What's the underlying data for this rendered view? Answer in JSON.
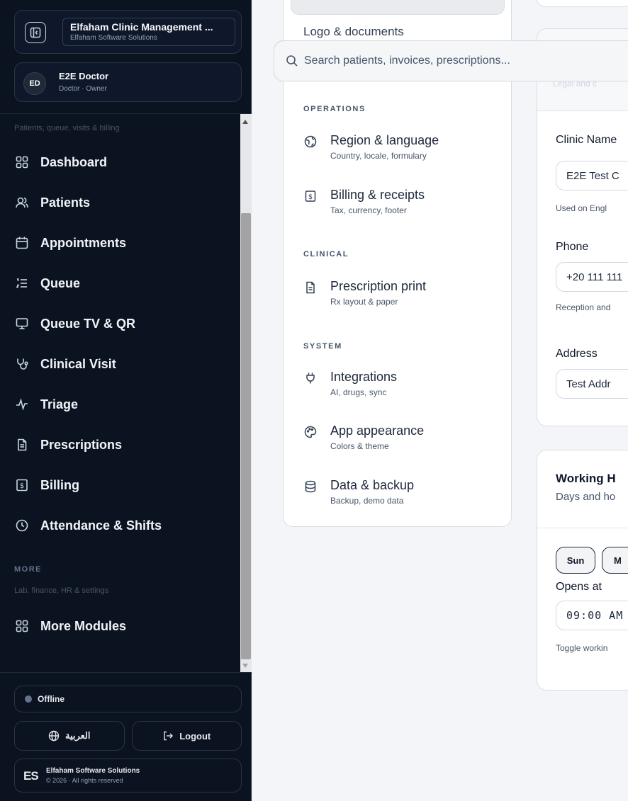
{
  "sidebar": {
    "brand": {
      "title": "Elfaham Clinic Management ...",
      "subtitle": "Elfaham Software Solutions"
    },
    "user": {
      "initials": "ED",
      "name": "E2E Doctor",
      "role": "Doctor · Owner"
    },
    "nav_caption": "Patients, queue, visits & billing",
    "items": [
      {
        "label": "Dashboard",
        "icon": "grid-icon"
      },
      {
        "label": "Patients",
        "icon": "users-icon"
      },
      {
        "label": "Appointments",
        "icon": "calendar-icon"
      },
      {
        "label": "Queue",
        "icon": "list-ordered-icon"
      },
      {
        "label": "Queue TV & QR",
        "icon": "monitor-icon"
      },
      {
        "label": "Clinical Visit",
        "icon": "stethoscope-icon"
      },
      {
        "label": "Triage",
        "icon": "activity-icon"
      },
      {
        "label": "Prescriptions",
        "icon": "file-text-icon"
      },
      {
        "label": "Billing",
        "icon": "receipt-icon"
      },
      {
        "label": "Attendance & Shifts",
        "icon": "clock-icon"
      }
    ],
    "more_heading": "MORE",
    "more_caption": "Lab, finance, HR & settings",
    "more_modules": "More Modules",
    "status": "Offline",
    "language_button": "العربية",
    "logout_button": "Logout",
    "footer": {
      "logo": "ES",
      "company": "Elfaham Software Solutions",
      "copyright": "© 2026 · All rights reserved"
    }
  },
  "search": {
    "placeholder": "Search patients, invoices, prescriptions..."
  },
  "settings_menu": {
    "peek_item": "Logo & documents",
    "sections": [
      {
        "heading": "OPERATIONS",
        "items": [
          {
            "title": "Region & language",
            "subtitle": "Country, locale, formulary",
            "icon": "globe-icon"
          },
          {
            "title": "Billing & receipts",
            "subtitle": "Tax, currency, footer",
            "icon": "receipt-icon"
          }
        ]
      },
      {
        "heading": "CLINICAL",
        "items": [
          {
            "title": "Prescription print",
            "subtitle": "Rx layout & paper",
            "icon": "file-text-icon"
          }
        ]
      },
      {
        "heading": "SYSTEM",
        "items": [
          {
            "title": "Integrations",
            "subtitle": "AI, drugs, sync",
            "icon": "plug-icon"
          },
          {
            "title": "App appearance",
            "subtitle": "Colors & theme",
            "icon": "palette-icon"
          },
          {
            "title": "Data & backup",
            "subtitle": "Backup, demo data",
            "icon": "database-icon"
          }
        ]
      }
    ]
  },
  "clinic_card": {
    "faded_subtitle": "Legal and c",
    "fields": [
      {
        "label": "Clinic Name",
        "value": "E2E Test C",
        "help": "Used on Engl"
      },
      {
        "label": "Phone",
        "value": "+20 111 111",
        "help": "Reception and"
      },
      {
        "label": "Address",
        "value": "Test Addr",
        "help": ""
      }
    ]
  },
  "hours_card": {
    "title": "Working H",
    "subtitle": "Days and ho",
    "days": [
      "Sun",
      "M"
    ],
    "opens_label": "Opens at",
    "opens_value": "09:00 AM",
    "help": "Toggle workin"
  }
}
